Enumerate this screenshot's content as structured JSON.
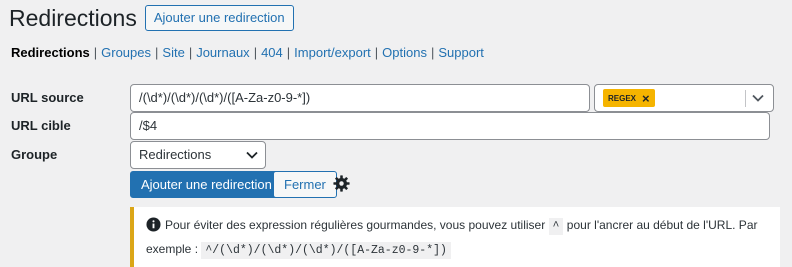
{
  "header": {
    "title": "Redirections",
    "add_button": "Ajouter une redirection"
  },
  "subnav": {
    "items": [
      "Redirections",
      "Groupes",
      "Site",
      "Journaux",
      "404",
      "Import/export",
      "Options",
      "Support"
    ],
    "separator": "|"
  },
  "form": {
    "source_label": "URL source",
    "source_value": "/(\\d*)/(\\d*)/(\\d*)/([A-Za-z0-9-*])",
    "flag_tag": "REGEX",
    "target_label": "URL cible",
    "target_value": "/$4",
    "group_label": "Groupe",
    "group_value": "Redirections",
    "submit_button": "Ajouter une redirection",
    "close_button": "Fermer"
  },
  "notice": {
    "text_before": "Pour éviter des expression régulières gourmandes, vous pouvez utiliser",
    "code_caret": "^",
    "text_middle": "pour l'ancrer au début de l'URL. Par exemple :",
    "code_example": "^/(\\d*)/(\\d*)/(\\d*)/([A-Za-z0-9-*])"
  },
  "colors": {
    "accent": "#2271b1",
    "regex_tag": "#f5b400",
    "notice_border": "#dba617"
  }
}
